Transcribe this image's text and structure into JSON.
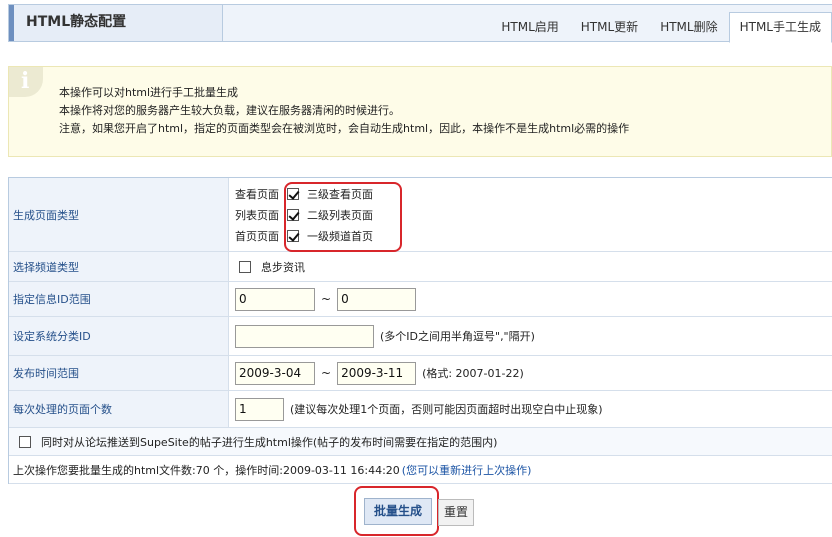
{
  "header": {
    "title": "HTML静态配置",
    "tabs": [
      {
        "label": "HTML启用"
      },
      {
        "label": "HTML更新"
      },
      {
        "label": "HTML删除"
      },
      {
        "label": "HTML手工生成"
      }
    ]
  },
  "info": {
    "lines": [
      "本操作可以对html进行手工批量生成",
      "本操作将对您的服务器产生较大负载，建议在服务器清闲的时候进行。",
      "注意，如果您开启了html，指定的页面类型会在被浏览时，会自动生成html，因此，本操作不是生成html必需的操作"
    ]
  },
  "form": {
    "page_type": {
      "label": "生成页面类型",
      "options": [
        {
          "name": "查看页面",
          "option": "三级查看页面",
          "checked": true
        },
        {
          "name": "列表页面",
          "option": "二级列表页面",
          "checked": true
        },
        {
          "name": "首页页面",
          "option": "一级频道首页",
          "checked": true
        }
      ]
    },
    "channel_type": {
      "label": "选择频道类型",
      "option": "息步资讯",
      "checked": false
    },
    "info_id_range": {
      "label": "指定信息ID范围",
      "from": "0",
      "separator": "~",
      "to": "0"
    },
    "category_id": {
      "label": "设定系统分类ID",
      "value": "",
      "hint": "(多个ID之间用半角逗号\",\"隔开)"
    },
    "time_range": {
      "label": "发布时间范围",
      "from": "2009-3-04",
      "separator": "~",
      "to": "2009-3-11",
      "hint": "(格式: 2007-01-22)"
    },
    "per_batch": {
      "label": "每次处理的页面个数",
      "value": "1",
      "hint": "(建议每次处理1个页面，否则可能因页面超时出现空白中止现象)"
    },
    "forum_sync": {
      "label": "同时对从论坛推送到SupeSite的帖子进行生成html操作(帖子的发布时间需要在指定的范围内)",
      "checked": false
    },
    "last_op": {
      "text": "上次操作您要批量生成的html文件数:70 个，操作时间:2009-03-11 16:44:20",
      "link": "(您可以重新进行上次操作)"
    }
  },
  "buttons": {
    "generate": "批量生成",
    "reset": "重置"
  },
  "colors": {
    "highlight": "#d8262b",
    "label_text": "#25508a",
    "link": "#1d55a5"
  }
}
